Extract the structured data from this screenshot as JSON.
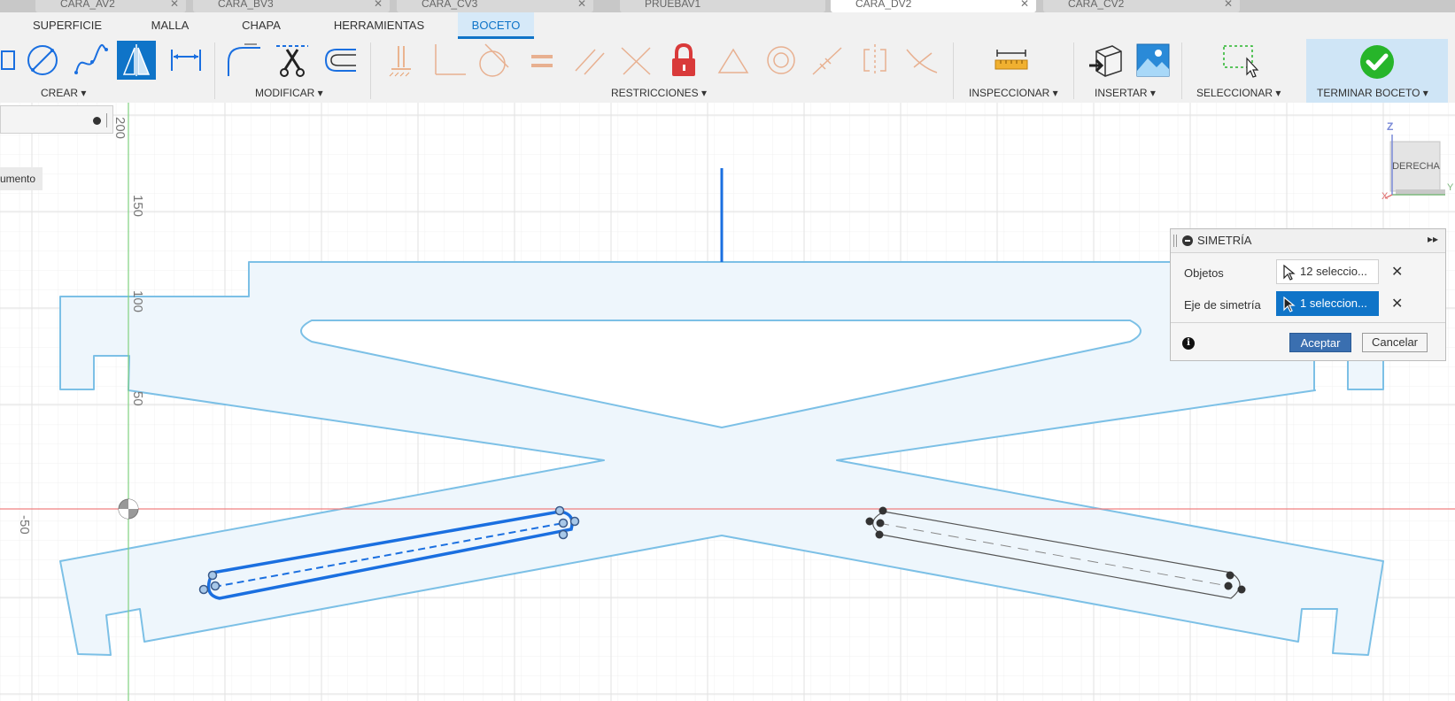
{
  "document_tabs": [
    {
      "label": "CARA_AV2",
      "active": false
    },
    {
      "label": "CARA_BV3",
      "active": false
    },
    {
      "label": "CARA_CV3",
      "active": false
    },
    {
      "label": "PRUEBAV1",
      "active": false
    },
    {
      "label": "CARA_DV2",
      "active": true
    },
    {
      "label": "CARA_CV2",
      "active": false
    }
  ],
  "toolbar_tabs": [
    {
      "label": "SUPERFICIE"
    },
    {
      "label": "MALLA"
    },
    {
      "label": "CHAPA"
    },
    {
      "label": "HERRAMIENTAS"
    },
    {
      "label": "BOCETO",
      "active": true
    }
  ],
  "tool_groups": {
    "crear": "CREAR ▾",
    "modificar": "MODIFICAR ▾",
    "restricciones": "RESTRICCIONES ▾",
    "inspeccionar": "INSPECCIONAR ▾",
    "insertar": "INSERTAR ▾",
    "seleccionar": "SELECCIONAR ▾",
    "terminar": "TERMINAR BOCETO ▾"
  },
  "ruler_labels": {
    "v200": "200",
    "v150": "150",
    "v100": "100",
    "v50": "50",
    "h_neg50": "-50"
  },
  "browser_panel": {
    "comment_label": "umento"
  },
  "viewcube": {
    "face_label": "DERECHA",
    "axis_z": "Z",
    "axis_x": "X",
    "axis_y": "Y"
  },
  "dialog": {
    "title": "SIMETRÍA",
    "objects_label": "Objetos",
    "objects_value": "12 seleccio...",
    "axis_label": "Eje de simetría",
    "axis_value": "1 seleccion...",
    "ok_label": "Aceptar",
    "cancel_label": "Cancelar",
    "info_symbol": "i",
    "clear_symbol": "✕",
    "expand_symbol": "▸▸"
  },
  "colors": {
    "accent_blue": "#0f74c8",
    "sketch_line": "#7cc0e6",
    "sketch_fill": "#eef6fc",
    "selected_line": "#1a6fe0",
    "x_axis": "#f08080",
    "y_axis": "#80d080",
    "finish_green": "#27b52a",
    "lock_red": "#d93a3a"
  }
}
